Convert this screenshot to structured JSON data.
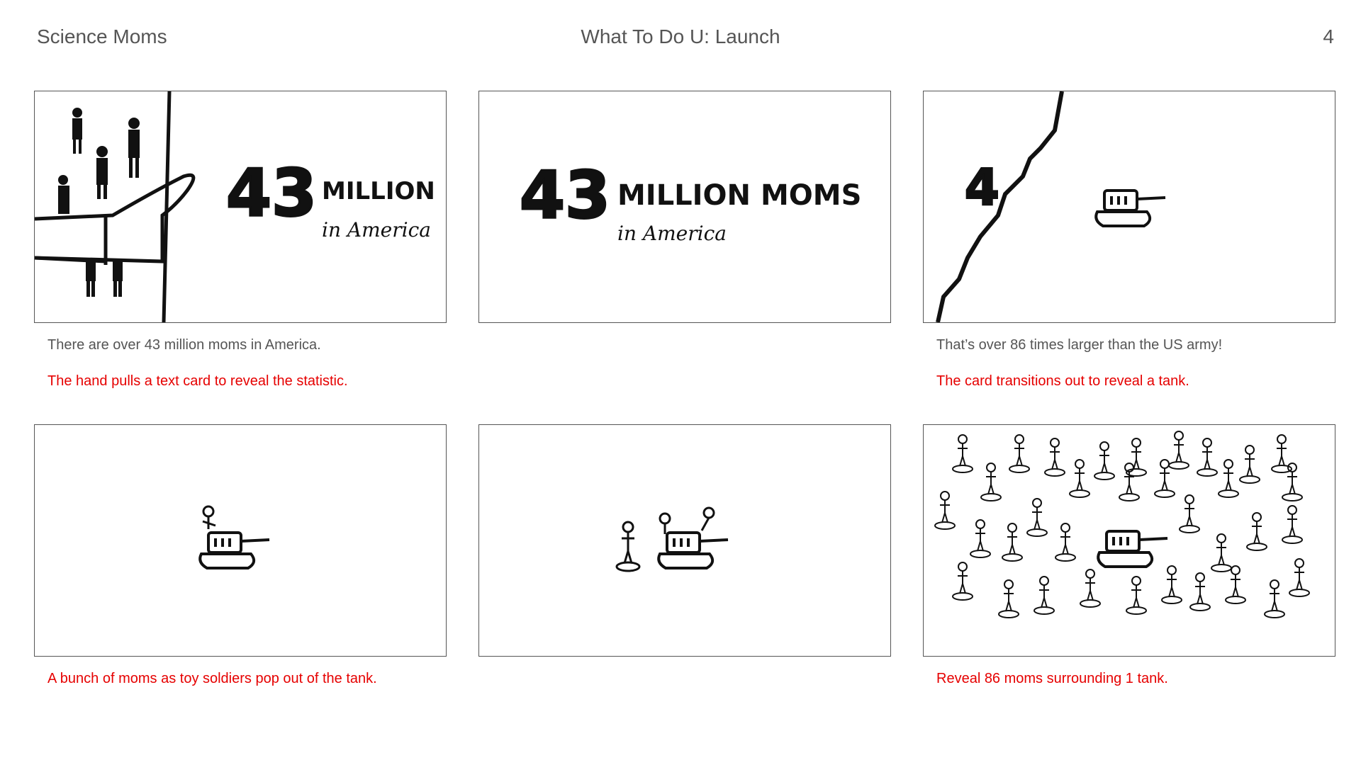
{
  "header": {
    "left": "Science Moms",
    "center": "What To Do U: Launch",
    "page": "4"
  },
  "panels": [
    {
      "big_number": "43",
      "word": "MILLION",
      "sub": "in America",
      "caption": "There are over 43 million moms in America.",
      "note": "The hand pulls a text card to reveal the statistic."
    },
    {
      "big_number": "43",
      "word": "MILLION MOMS",
      "sub": "in America",
      "caption": "",
      "note": ""
    },
    {
      "fragment": "4",
      "caption": "That’s over 86 times larger than the US army!",
      "note": "The card transitions out to reveal a tank."
    },
    {
      "caption": "",
      "note": "A bunch of moms as toy soldiers pop out of the tank."
    },
    {
      "caption": "",
      "note": ""
    },
    {
      "caption": "",
      "note": "Reveal 86 moms surrounding 1 tank."
    }
  ]
}
